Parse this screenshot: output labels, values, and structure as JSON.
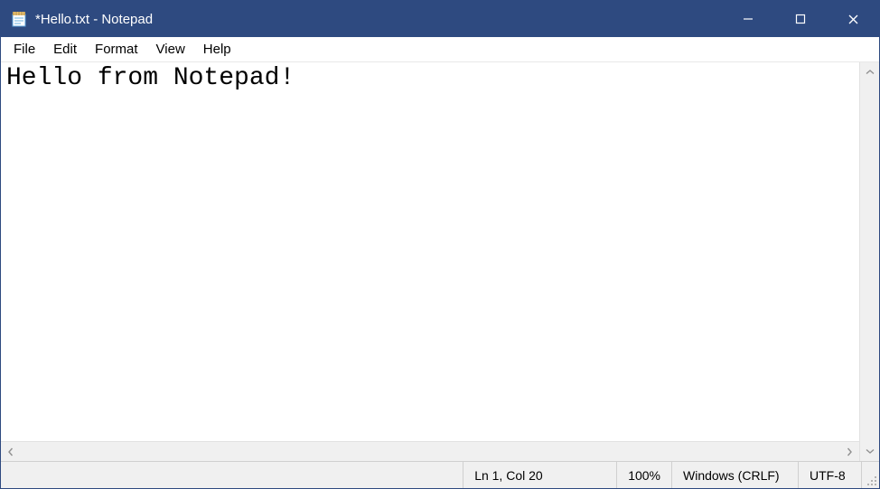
{
  "titlebar": {
    "title": "*Hello.txt - Notepad"
  },
  "menubar": {
    "items": [
      "File",
      "Edit",
      "Format",
      "View",
      "Help"
    ]
  },
  "editor": {
    "content": "Hello from Notepad!"
  },
  "statusbar": {
    "position": "Ln 1, Col 20",
    "zoom": "100%",
    "line_ending": "Windows (CRLF)",
    "encoding": "UTF-8"
  }
}
